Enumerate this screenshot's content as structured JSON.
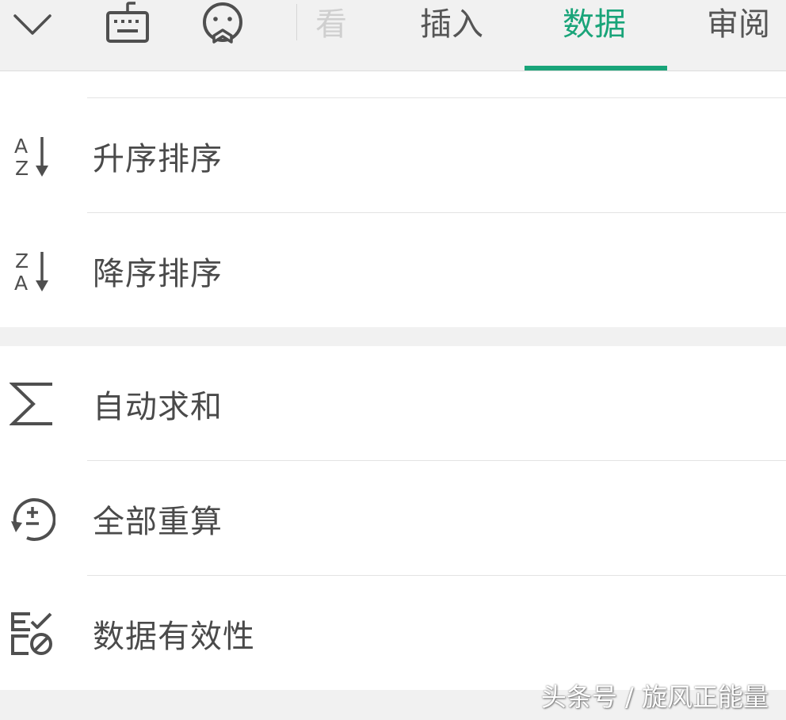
{
  "toolbar": {
    "icons": {
      "collapse": "chevron-down-icon",
      "keyboard": "keyboard-icon",
      "emoji": "emoji-icon"
    },
    "tabs": [
      {
        "label": "看",
        "state": "partially-hidden"
      },
      {
        "label": "插入",
        "state": "normal"
      },
      {
        "label": "数据",
        "state": "active"
      },
      {
        "label": "审阅",
        "state": "normal"
      }
    ]
  },
  "menu": {
    "group1": [
      {
        "label": "升序排序",
        "icon": "sort-ascending-icon"
      },
      {
        "label": "降序排序",
        "icon": "sort-descending-icon"
      }
    ],
    "group2": [
      {
        "label": "自动求和",
        "icon": "sum-icon"
      },
      {
        "label": "全部重算",
        "icon": "recalculate-icon"
      },
      {
        "label": "数据有效性",
        "icon": "data-validation-icon"
      }
    ]
  },
  "watermark": "头条号 / 旋风正能量",
  "colors": {
    "accent": "#19a479",
    "toolbar_bg": "#f1f1f1",
    "text": "#4a4a4a",
    "icon": "#4f4f4f",
    "divider": "#e3e3e3"
  }
}
